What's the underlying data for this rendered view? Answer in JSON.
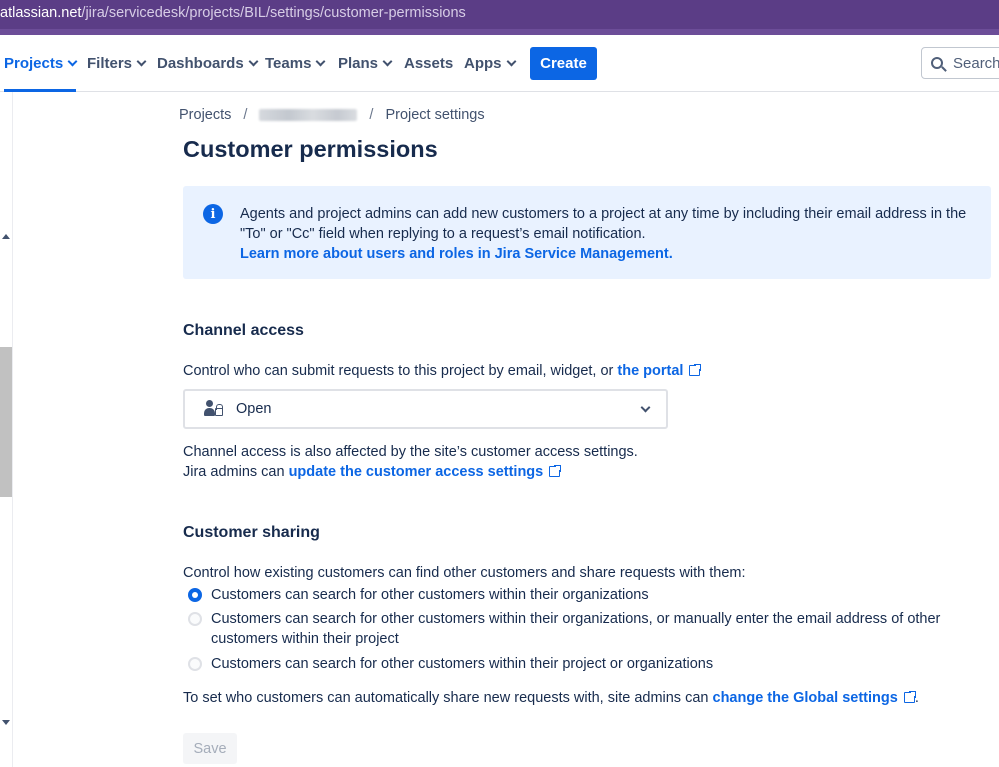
{
  "browser": {
    "url_host": "atlassian.net",
    "url_path": "/jira/servicedesk/projects/BIL/settings/customer-permissions"
  },
  "topnav": {
    "items": [
      {
        "label": "Projects",
        "has_dropdown": true,
        "active": true
      },
      {
        "label": "Filters",
        "has_dropdown": true
      },
      {
        "label": "Dashboards",
        "has_dropdown": true
      },
      {
        "label": "Teams",
        "has_dropdown": true
      },
      {
        "label": "Plans",
        "has_dropdown": true
      },
      {
        "label": "Assets",
        "has_dropdown": false
      },
      {
        "label": "Apps",
        "has_dropdown": true
      }
    ],
    "create_label": "Create",
    "search_placeholder": "Search"
  },
  "breadcrumb": {
    "projects": "Projects",
    "separator": "/",
    "settings": "Project settings"
  },
  "page_title": "Customer permissions",
  "info_panel": {
    "line1": "Agents and project admins can add new customers to a project at any time by including their email address in the",
    "line2": "\"To\" or \"Cc\" field when replying to a request’s email notification.",
    "link": "Learn more about users and roles in Jira Service Management."
  },
  "channel_access": {
    "title": "Channel access",
    "description": "Control who can submit requests to this project by email, widget, or",
    "portal_link": "the portal",
    "selected_value": "Open",
    "note_line1": "Channel access is also affected by the site’s customer access settings.",
    "note_line2_prefix": "Jira admins can",
    "note_link": "update the customer access settings"
  },
  "customer_sharing": {
    "title": "Customer sharing",
    "description": "Control how existing customers can find other customers and share requests with them:",
    "options": [
      {
        "label": "Customers can search for other customers within their organizations",
        "checked": true
      },
      {
        "label_line1": "Customers can search for other customers within their organizations, or manually enter the email address of other",
        "label_line2": "customers within their project",
        "checked": false
      },
      {
        "label": "Customers can search for other customers within their project or organizations",
        "checked": false
      }
    ],
    "footer_prefix": "To set who customers can automatically share new requests with, site admins can",
    "footer_link": "change the Global settings",
    "footer_suffix": "."
  },
  "save_label": "Save",
  "colors": {
    "accent": "#0c66e4",
    "url_bar": "#5b3d86",
    "info_bg": "#e9f2ff",
    "text": "#172b4d"
  }
}
